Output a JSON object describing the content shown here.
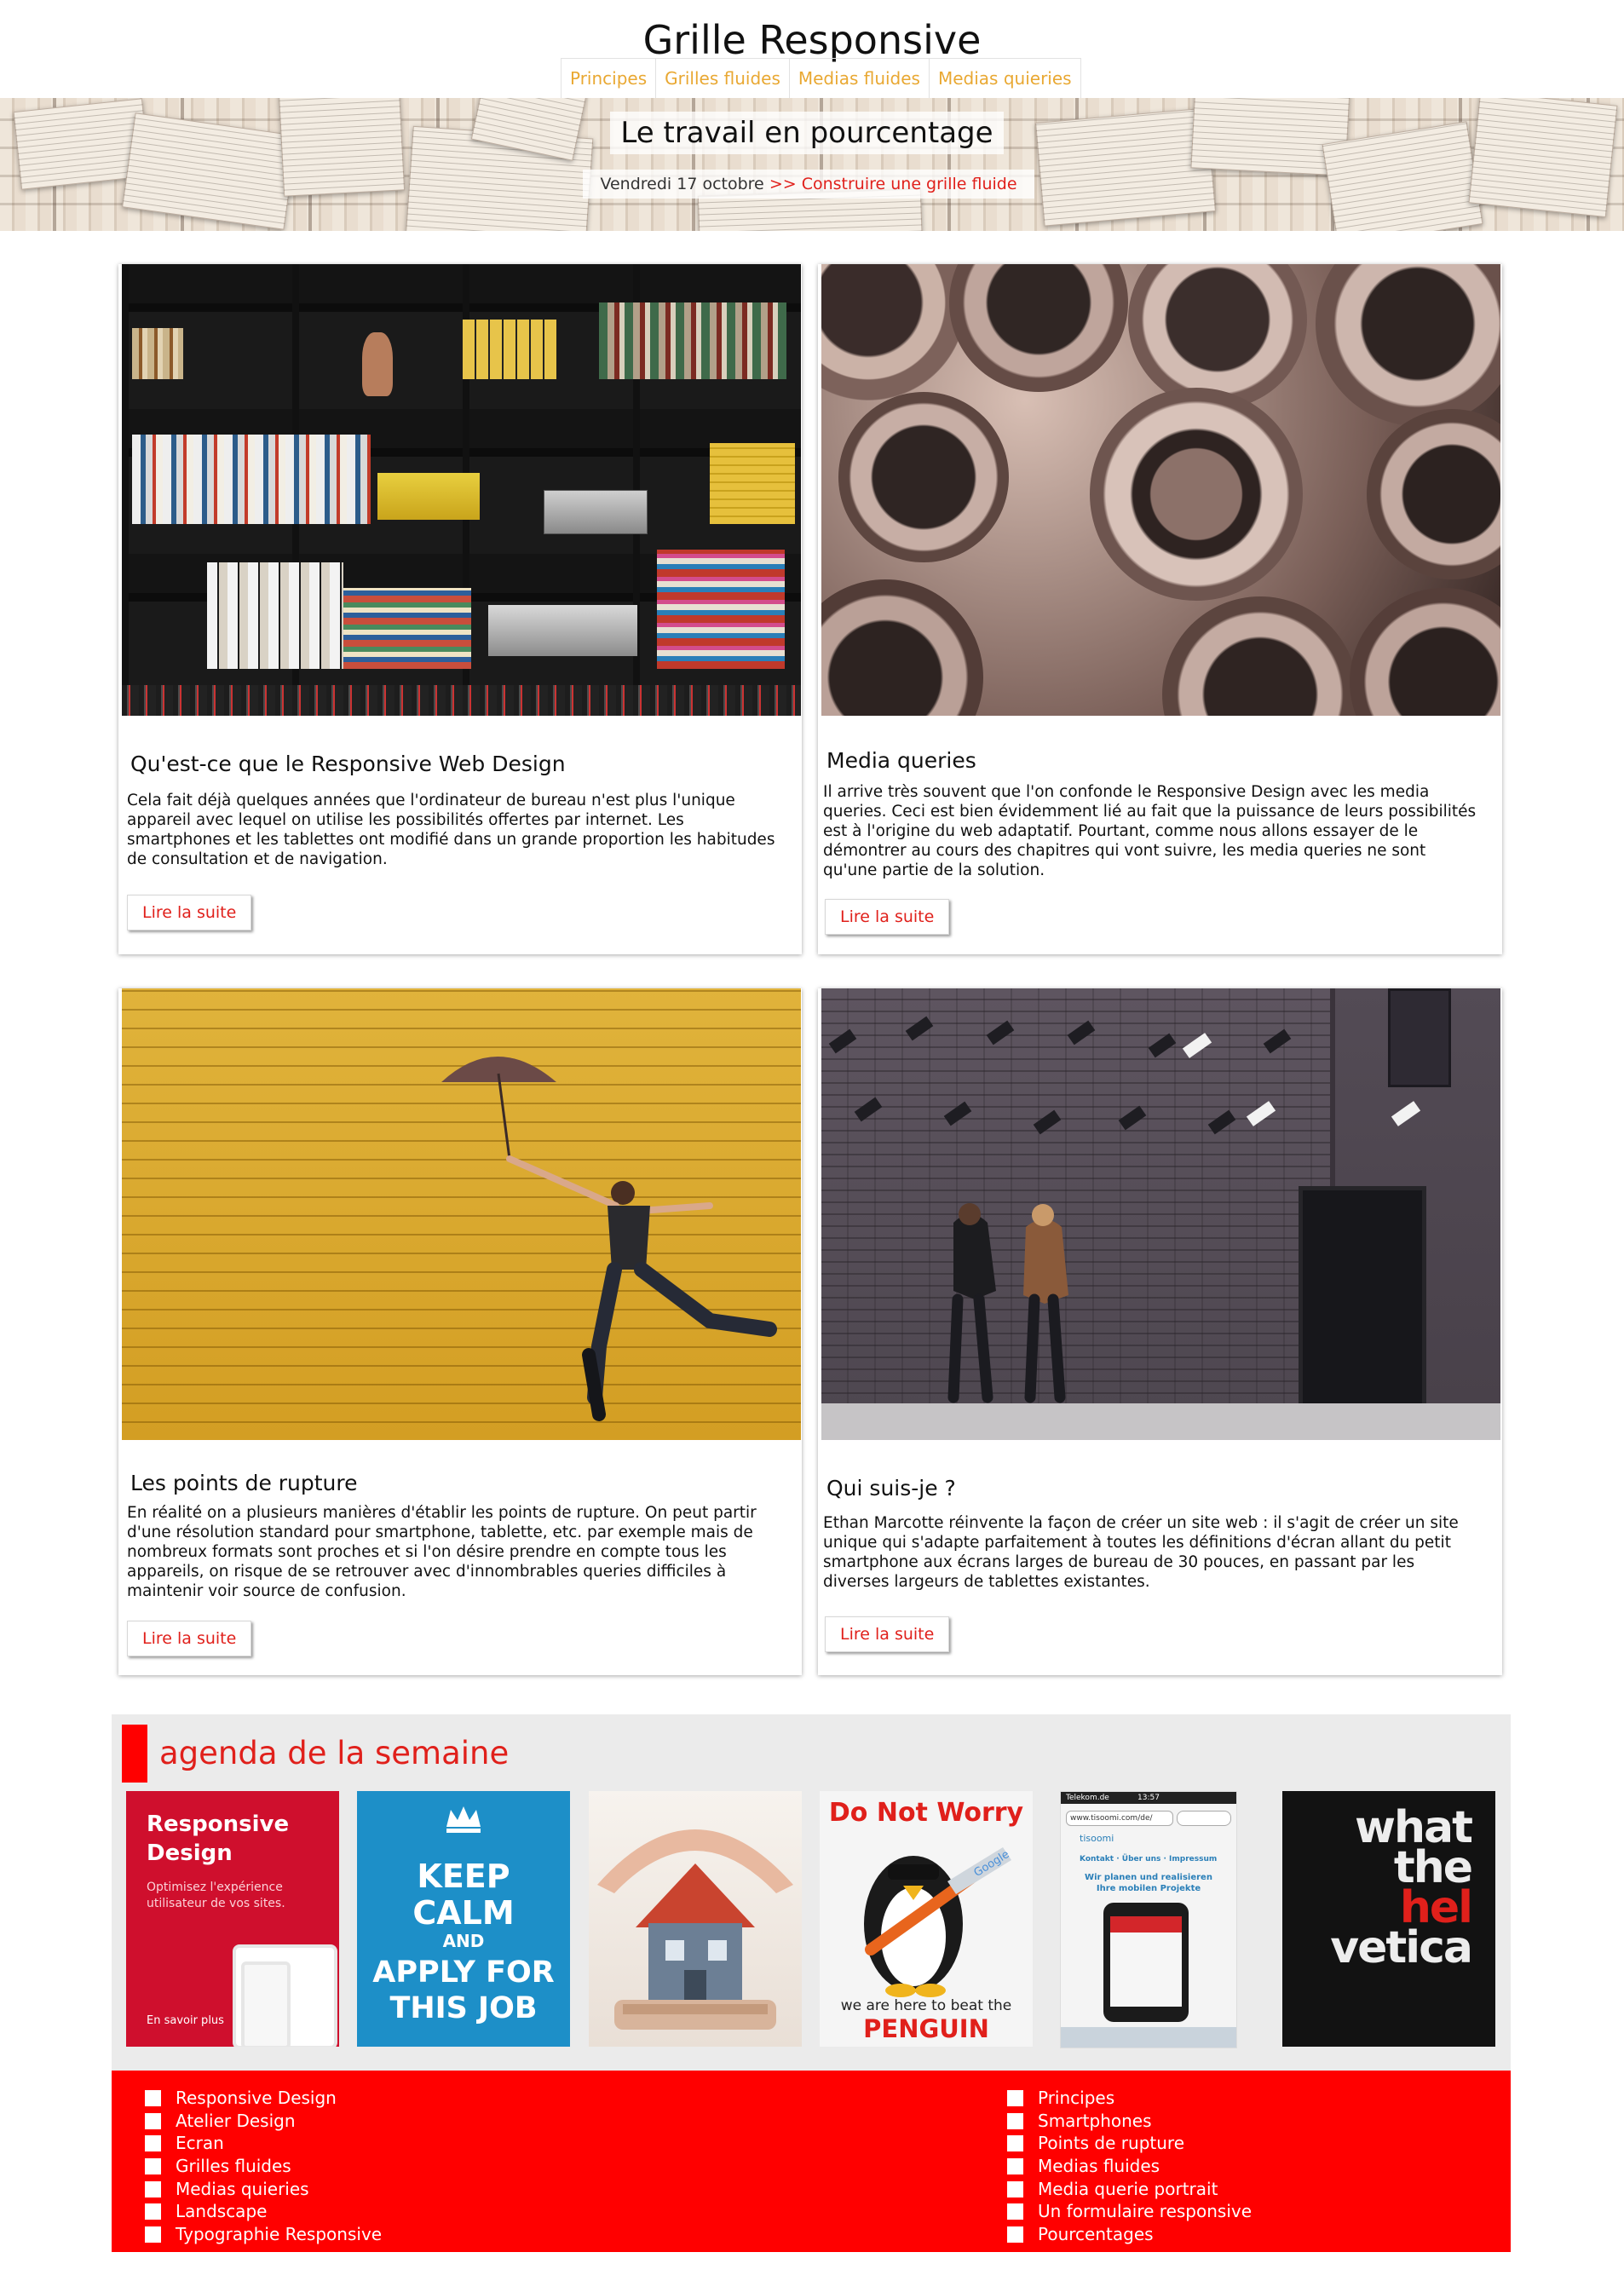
{
  "header": {
    "title": "Grille Responsive",
    "nav": [
      "Principes",
      "Grilles fluides",
      "Medias fluides",
      "Medias quieries"
    ]
  },
  "banner": {
    "title": "Le travail en pourcentage",
    "date": "Vendredi 17 octobre",
    "separator": ">>",
    "link": "Construire une grille fluide"
  },
  "cards": [
    {
      "title": "Qu'est-ce que le Responsive Web Design",
      "text": "Cela fait déjà quelques années que l'ordinateur de bureau n'est plus l'unique appareil avec lequel on utilise les possibilités offertes par internet. Les smartphones et les tablettes ont modifié dans un grande proportion les habitudes de consultation et de navigation.",
      "button": "Lire la suite",
      "image": "bookshelf"
    },
    {
      "title": "Media queries",
      "text": "Il arrive très souvent que l'on confonde le Responsive Design avec les media queries. Ceci est bien évidemment lié au fait que la puissance de leurs possibilités est à l'origine du web adaptatif. Pourtant, comme nous allons essayer de le démontrer au cours des chapitres qui vont suivre, les media queries ne sont qu'une partie de la solution.",
      "button": "Lire la suite",
      "image": "metal bolts"
    },
    {
      "title": "Les points de rupture",
      "text": "En réalité on a plusieurs manières d'établir les points de rupture. On peut partir d'une résolution standard pour smartphone, tablette, etc. par exemple mais de nombreux formats sont proches et si l'on désire prendre en compte tous les appareils, on risque de se retrouver avec d'innombrables queries difficiles à maintenir voir source de confusion.",
      "button": "Lire la suite",
      "image": "woman with umbrella on yellow wall"
    },
    {
      "title": "Qui suis-je ?",
      "text": "Ethan Marcotte réinvente la façon de créer un site web : il s'agit de créer un site unique qui s'adapte parfaitement à toutes les définitions d'écran allant du petit smartphone aux écrans larges de bureau de 30 pouces, en passant par les diverses largeurs de tablettes existantes.",
      "button": "Lire la suite",
      "image": "two women under cameras"
    }
  ],
  "agenda": {
    "title": "agenda de la semaine",
    "tiles": {
      "rd_title_1": "Responsive",
      "rd_title_2": "Design",
      "rd_sub_1": "Optimisez l'expérience",
      "rd_sub_2": "utilisateur de vos sites.",
      "rd_link": "En savoir plus",
      "kc_1": "KEEP",
      "kc_2": "CALM",
      "kc_3": "AND",
      "kc_4": "APPLY FOR",
      "kc_5": "THIS JOB",
      "dnw_title": "Do Not Worry",
      "dnw_line": "we are here to beat the",
      "dnw_big": "PENGUIN",
      "dnw_brand": "Google",
      "phone_status": "Telekom.de",
      "phone_time": "13:57",
      "phone_url": "www.tisoomi.com/de/",
      "phone_site": "tisoomi",
      "phone_nav": "Kontakt · Über uns · Impressum",
      "phone_head_1": "Wir planen und realisieren",
      "phone_head_2": "Ihre mobilen Projekte",
      "wh_1": "what",
      "wh_2": "the",
      "wh_3a": "hel",
      "wh_3b": "vetica"
    }
  },
  "footer": {
    "col1": [
      "Responsive Design",
      "Atelier Design",
      "Ecran",
      "Grilles fluides",
      "Medias quieries",
      "Landscape",
      "Typographie Responsive"
    ],
    "col2": [
      "Principes",
      "Smartphones",
      "Points de rupture",
      "Medias fluides",
      "Media querie portrait",
      "Un formulaire responsive",
      "Pourcentages"
    ]
  },
  "colors": {
    "accent": "#ff0000",
    "nav_link": "#e9a832",
    "agenda_bg": "#ebebeb"
  }
}
